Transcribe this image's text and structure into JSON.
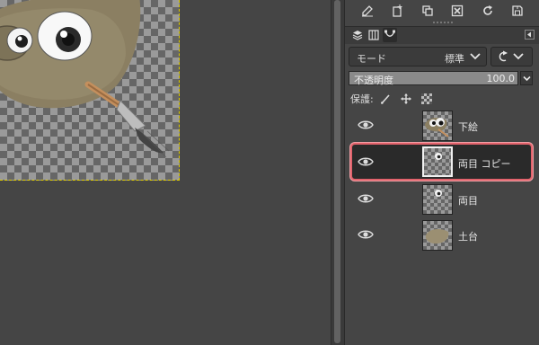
{
  "canvas": {
    "description_icon": "gimp-wilber-artwork"
  },
  "dock": {
    "toolbar_icons": [
      "edit-icon",
      "new-document-icon",
      "duplicate-icon",
      "clear-icon",
      "refresh-icon",
      "save-icon"
    ],
    "tabs": [
      "layers-icon",
      "channels-icon",
      "paths-icon"
    ],
    "mode_label": "モード",
    "mode_value": "標準",
    "opacity_label": "不透明度",
    "opacity_value": "100.0",
    "opacity_percent": 100,
    "lock_label": "保護:"
  },
  "layers": [
    {
      "name": "下絵",
      "visible": true,
      "thumb": "wilber-thumb"
    },
    {
      "name": "両目 コピー",
      "visible": true,
      "thumb": "eye-dot-thumb",
      "selected": true
    },
    {
      "name": "両目",
      "visible": true,
      "thumb": "eye-dot-thumb"
    },
    {
      "name": "土台",
      "visible": true,
      "thumb": "base-thumb"
    }
  ],
  "colors": {
    "selection_border": "#e2636c",
    "canvas_boundary": "#e6d200",
    "background": "#454545"
  }
}
